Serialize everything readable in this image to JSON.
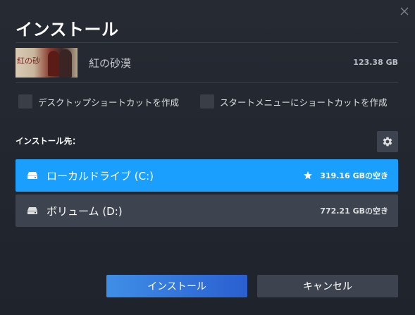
{
  "dialog": {
    "title": "インストール",
    "close_icon": "close-icon"
  },
  "game": {
    "name": "紅の砂漠",
    "size": "123.38 GB",
    "thumbnail_text": "紅の砂"
  },
  "options": {
    "desktop_shortcut": {
      "label": "デスクトップショートカットを作成",
      "checked": false
    },
    "start_menu_shortcut": {
      "label": "スタートメニューにショートカットを作成",
      "checked": false
    }
  },
  "destination": {
    "label": "インストール先：",
    "settings_icon": "gear-icon",
    "drives": [
      {
        "name": "ローカルドライブ (C:)",
        "free": "319.16 GBの空き",
        "selected": true,
        "favorite": true,
        "icon": "drive-icon"
      },
      {
        "name": "ボリューム (D:)",
        "free": "772.21 GBの空き",
        "selected": false,
        "favorite": false,
        "icon": "drive-icon"
      }
    ]
  },
  "buttons": {
    "install": "インストール",
    "cancel": "キャンセル"
  },
  "colors": {
    "background": "#22262e",
    "selected_drive": "#1a9fff",
    "unselected_drive": "#3d4450",
    "install_button": "#2f74e0",
    "cancel_button": "#3d4450"
  }
}
